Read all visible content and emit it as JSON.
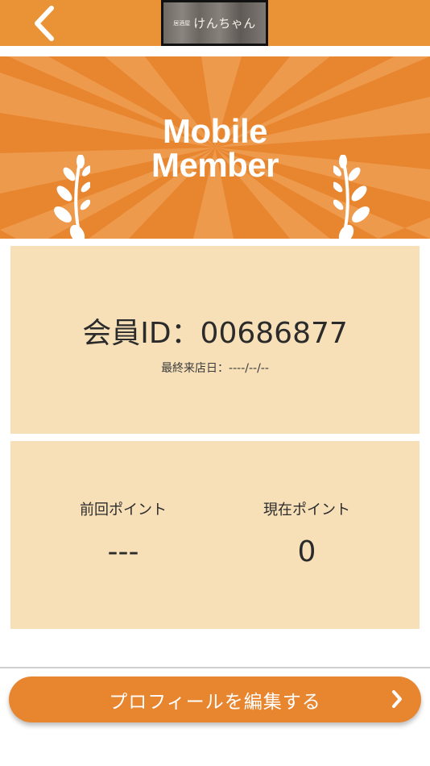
{
  "header": {
    "logo_small": "居酒屋",
    "logo_text": "けんちゃん",
    "back_icon": "chevron-left-icon"
  },
  "banner": {
    "title_line1": "Mobile",
    "title_line2": "Member"
  },
  "member": {
    "id_text": "会員ID：00686877",
    "last_visit": "最終来店日：----/--/--"
  },
  "points": {
    "previous_label": "前回ポイント",
    "previous_value": "---",
    "current_label": "現在ポイント",
    "current_value": "0"
  },
  "footer": {
    "edit_button_label": "プロフィールを編集する",
    "chevron_icon": "chevron-right-icon"
  },
  "colors": {
    "accent": "#ea9336",
    "banner": "#e8852f",
    "card": "#f7e0b8"
  }
}
